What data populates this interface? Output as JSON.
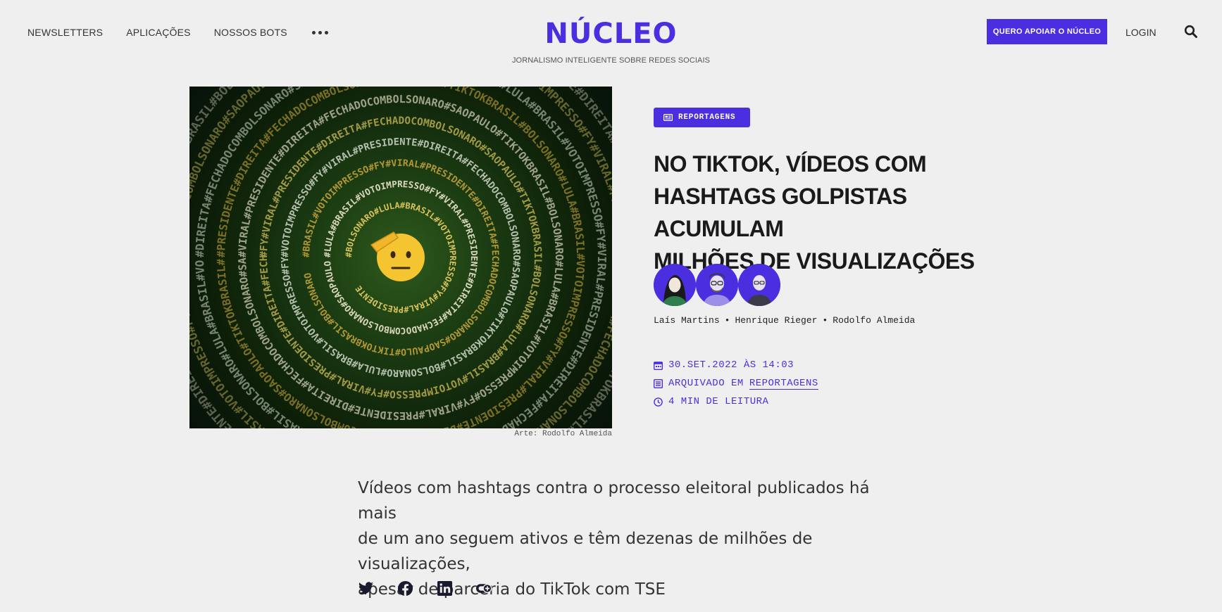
{
  "nav": {
    "items": [
      "NEWSLETTERS",
      "APLICAÇÕES",
      "NOSSOS BOTS"
    ],
    "more_icon": "more-dots-icon"
  },
  "brand": {
    "logo": "NÚCLEO",
    "tagline": "JORNALISMO INTELIGENTE SOBRE REDES SOCIAIS",
    "color": "#4b2ee0"
  },
  "header_actions": {
    "support_label": "QUERO APOIAR O NÚCLEO",
    "login_label": "LOGIN",
    "search_icon": "search-icon"
  },
  "article": {
    "image_caption": "Arte: Rodolfo Almeida",
    "image_words": [
      "#BOLSONARO",
      "#LULA",
      "#BRASIL",
      "#VOTOIMPRESSO",
      "#FY",
      "#VIRAL",
      "#PRESIDENTE",
      "#DIREITA",
      "#FECHADOCOMBOLSONARO",
      "#SAOPAULO",
      "#TIKTOKBRASIL"
    ],
    "category": "REPORTAGENS",
    "headline": [
      "NO TIKTOK, VÍDEOS COM",
      "HASHTAGS GOLPISTAS ACUMULAM",
      "MILHÕES DE VISUALIZAÇÕES"
    ],
    "authors": [
      "Laís Martins",
      "Henrique Rieger",
      "Rodolfo Almeida"
    ],
    "author_separator": "•",
    "date": "30.SET.2022 ÀS 14:03",
    "archived_prefix": "ARQUIVADO EM",
    "archived_link": "REPORTAGENS",
    "reading_time": "4 MIN DE LEITURA",
    "summary": [
      "Vídeos com hashtags contra o processo eleitoral publicados há mais",
      "de um ano seguem ativos e têm dezenas de milhões de visualizações,",
      "apesar de parceria do TikTok com TSE"
    ]
  },
  "share_icons": [
    "twitter-icon",
    "facebook-icon",
    "linkedin-icon",
    "copy-link-icon"
  ]
}
